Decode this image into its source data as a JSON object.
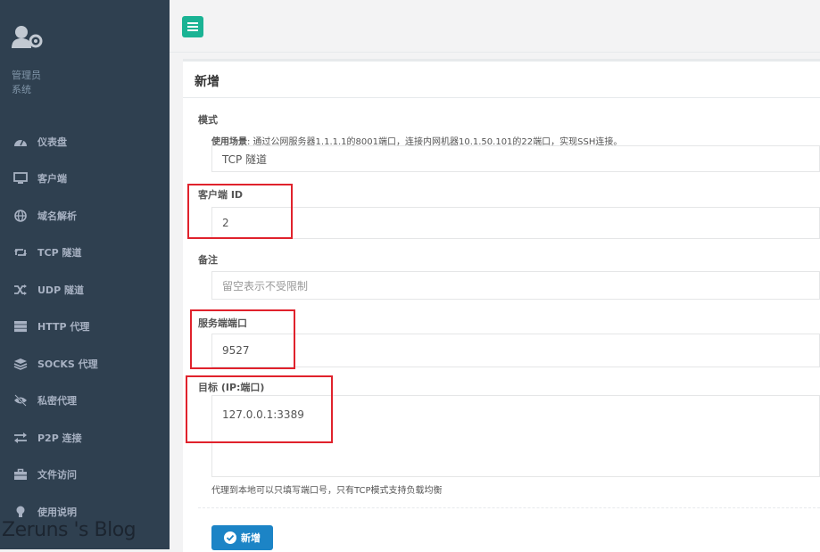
{
  "sidebar": {
    "profile": {
      "role": "管理员",
      "subtitle": "系统"
    },
    "items": [
      {
        "icon": "dashboard-icon",
        "label": "仪表盘"
      },
      {
        "icon": "desktop-icon",
        "label": "客户端"
      },
      {
        "icon": "globe-icon",
        "label": "域名解析"
      },
      {
        "icon": "retweet-icon",
        "label": "TCP 隧道"
      },
      {
        "icon": "random-icon",
        "label": "UDP 隧道"
      },
      {
        "icon": "server-icon",
        "label": "HTTP 代理"
      },
      {
        "icon": "layers-icon",
        "label": "SOCKS 代理"
      },
      {
        "icon": "eye-slash-icon",
        "label": "私密代理"
      },
      {
        "icon": "exchange-icon",
        "label": "P2P 连接"
      },
      {
        "icon": "briefcase-icon",
        "label": "文件访问"
      },
      {
        "icon": "lightbulb-icon",
        "label": "使用说明"
      }
    ]
  },
  "watermark": "Zeruns 's Blog",
  "panel": {
    "title": "新增",
    "mode": {
      "label": "模式",
      "hint_prefix": "使用场景",
      "hint_text": ": 通过公网服务器1.1.1.1的8001端口，连接内网机器10.1.50.101的22端口，实现SSH连接。",
      "value": "TCP 隧道"
    },
    "client_id": {
      "label": "客户端 ID",
      "value": "2"
    },
    "remark": {
      "label": "备注",
      "placeholder": "留空表示不受限制"
    },
    "server_port": {
      "label": "服务端端口",
      "value": "9527"
    },
    "target": {
      "label": "目标 (IP:端口)",
      "value": "127.0.0.1:3389",
      "help": "代理到本地可以只填写端口号，只有TCP模式支持负载均衡"
    },
    "submit_label": "新增"
  },
  "colors": {
    "sidebar_bg": "#2f4050",
    "toggle_green": "#1ab394",
    "primary_blue": "#1c84c6",
    "highlight_red": "#e0222c"
  }
}
